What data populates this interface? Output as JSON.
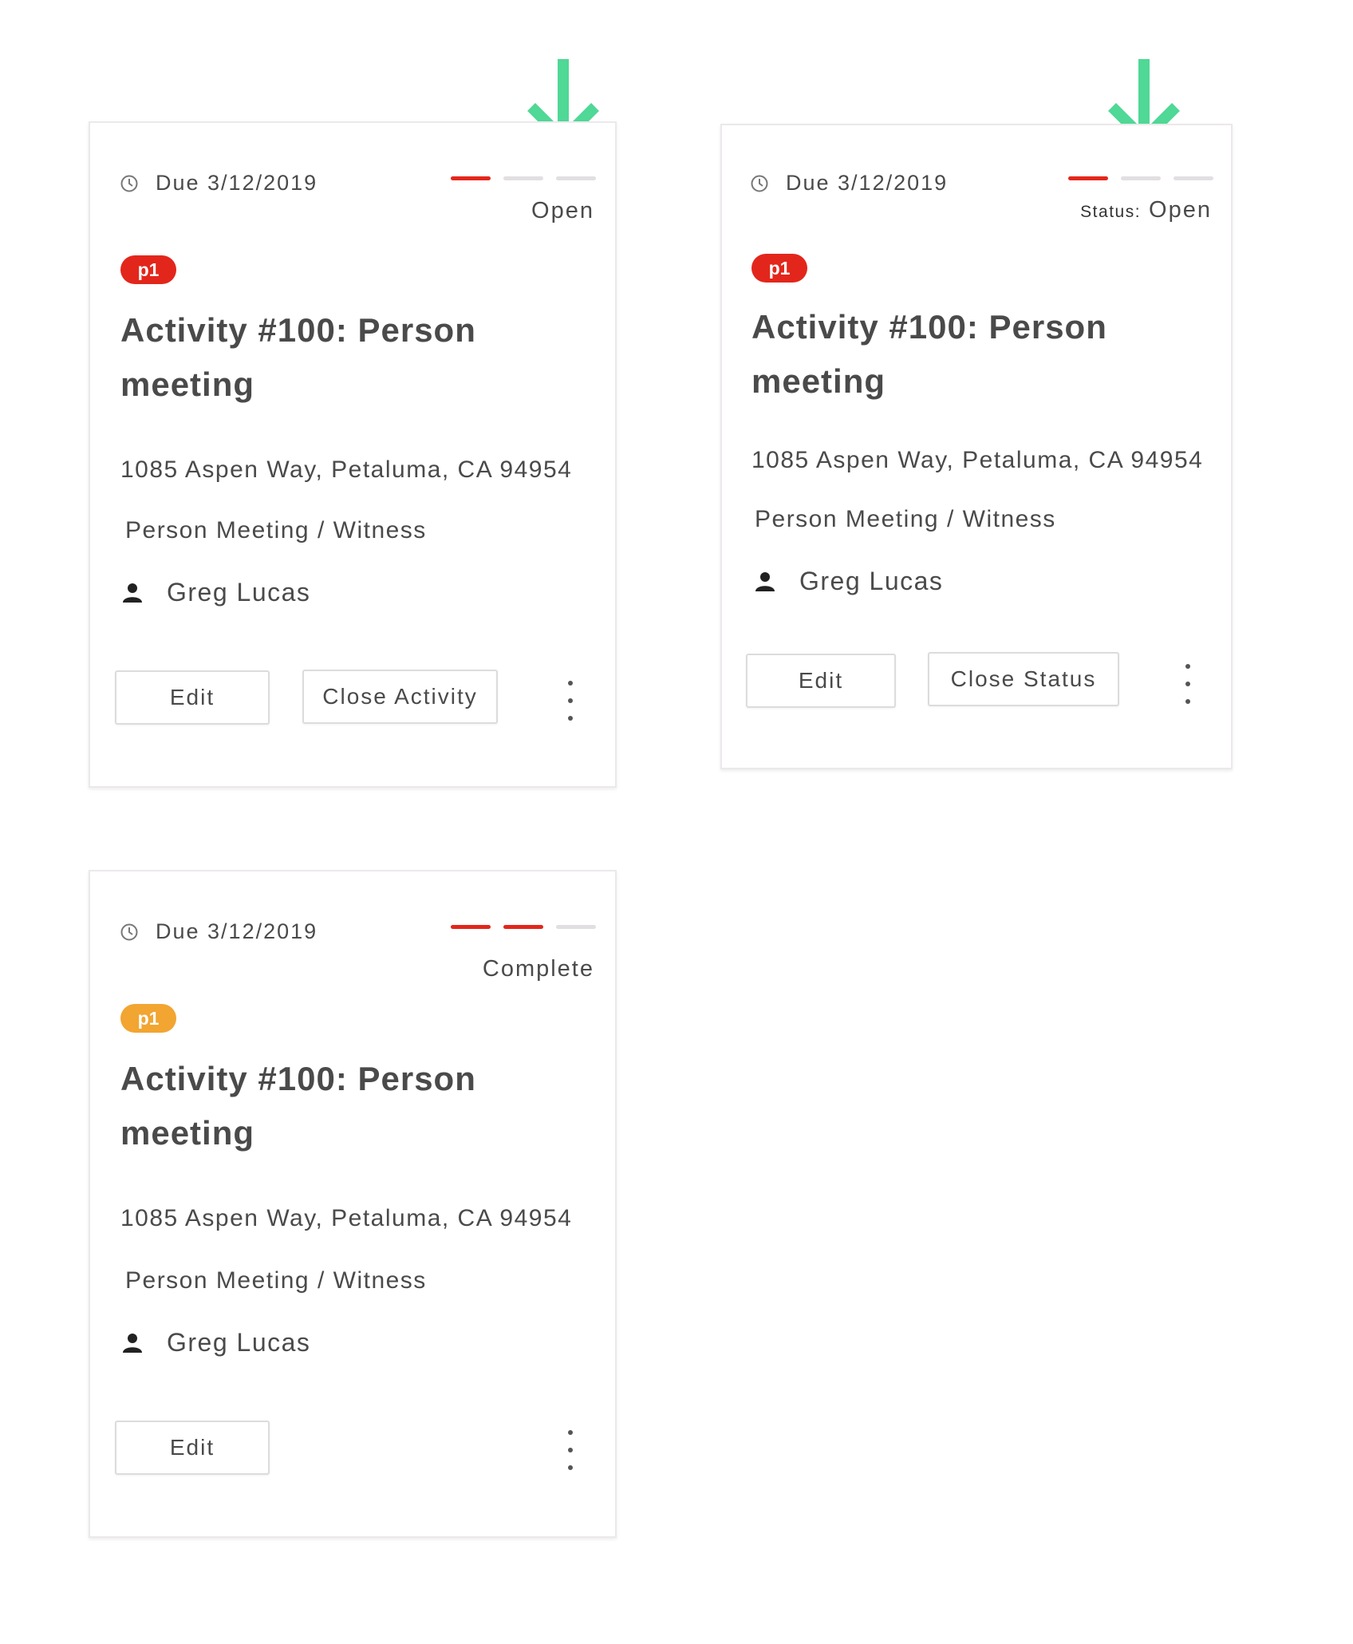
{
  "annotation": {
    "arrow_color": "#4fd896",
    "icon": "arrow-down-icon"
  },
  "colors": {
    "progress_active": "#e3261b",
    "progress_inactive": "#e2dfe2",
    "badge_red": "#e3261b",
    "badge_orange": "#f2a531"
  },
  "cards": [
    {
      "due": "Due 3/12/2019",
      "progress": [
        true,
        false,
        false
      ],
      "status_prefix": "",
      "status": "Open",
      "priority": "p1",
      "priority_color": "red",
      "title": "Activity #100: Person meeting",
      "address": "1085 Aspen Way, Petaluma, CA 94954",
      "type": "Person Meeting / Witness",
      "assignee": "Greg Lucas",
      "buttons": [
        "Edit",
        "Close Activity"
      ]
    },
    {
      "due": "Due 3/12/2019",
      "progress": [
        true,
        false,
        false
      ],
      "status_prefix": "Status:",
      "status": "Open",
      "priority": "p1",
      "priority_color": "red",
      "title": "Activity #100: Person meeting",
      "address": "1085 Aspen Way, Petaluma, CA 94954",
      "type": "Person Meeting / Witness",
      "assignee": "Greg Lucas",
      "buttons": [
        "Edit",
        "Close Status"
      ]
    },
    {
      "due": "Due 3/12/2019",
      "progress": [
        true,
        true,
        false
      ],
      "status_prefix": "",
      "status": "Complete",
      "priority": "p1",
      "priority_color": "orange",
      "title": "Activity #100: Person meeting",
      "address": "1085 Aspen Way, Petaluma, CA 94954",
      "type": "Person Meeting / Witness",
      "assignee": "Greg Lucas",
      "buttons": [
        "Edit"
      ]
    }
  ]
}
